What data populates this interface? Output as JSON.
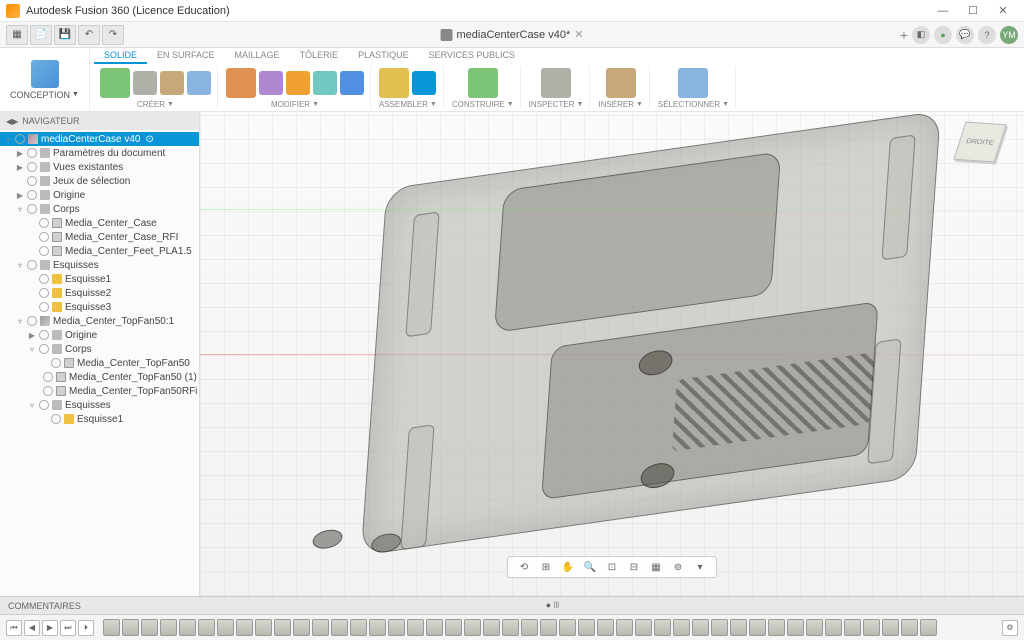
{
  "window": {
    "title": "Autodesk Fusion 360 (Licence Education)",
    "minimize": "—",
    "maximize": "☐",
    "close": "✕"
  },
  "doctab": {
    "name": "mediaCenterCase v40*",
    "add": "+",
    "status": "●",
    "help": "?",
    "user": "YM"
  },
  "ribbon": {
    "workspace": "CONCEPTION",
    "tabs": [
      "SOLIDE",
      "EN SURFACE",
      "MAILLAGE",
      "TÔLERIE",
      "PLASTIQUE",
      "SERVICES PUBLICS"
    ],
    "active_tab": 0,
    "groups": [
      {
        "label": "CRÉER",
        "tools": 4
      },
      {
        "label": "MODIFIER",
        "tools": 5
      },
      {
        "label": "ASSEMBLER",
        "tools": 2
      },
      {
        "label": "CONSTRUIRE",
        "tools": 1
      },
      {
        "label": "INSPECTER",
        "tools": 1
      },
      {
        "label": "INSÉRER",
        "tools": 1
      },
      {
        "label": "SÉLECTIONNER",
        "tools": 1
      }
    ]
  },
  "browser": {
    "title": "NAVIGATEUR",
    "root": "mediaCenterCase v40",
    "nodes": [
      {
        "d": 1,
        "exp": "▶",
        "icon": "gear",
        "label": "Paramètres du document"
      },
      {
        "d": 1,
        "exp": "▶",
        "icon": "folder",
        "label": "Vues existantes"
      },
      {
        "d": 1,
        "exp": "",
        "icon": "folder",
        "label": "Jeux de sélection"
      },
      {
        "d": 1,
        "exp": "▶",
        "icon": "folder",
        "label": "Origine"
      },
      {
        "d": 1,
        "exp": "▿",
        "icon": "folder",
        "label": "Corps"
      },
      {
        "d": 2,
        "exp": "",
        "icon": "body",
        "label": "Media_Center_Case"
      },
      {
        "d": 2,
        "exp": "",
        "icon": "body",
        "label": "Media_Center_Case_RFI"
      },
      {
        "d": 2,
        "exp": "",
        "icon": "body",
        "label": "Media_Center_Feet_PLA1.5"
      },
      {
        "d": 1,
        "exp": "▿",
        "icon": "folder",
        "label": "Esquisses"
      },
      {
        "d": 2,
        "exp": "",
        "icon": "sketch",
        "label": "Esquisse1"
      },
      {
        "d": 2,
        "exp": "",
        "icon": "sketch",
        "label": "Esquisse2"
      },
      {
        "d": 2,
        "exp": "",
        "icon": "sketch",
        "label": "Esquisse3"
      },
      {
        "d": 1,
        "exp": "▿",
        "icon": "comp",
        "label": "Media_Center_TopFan50:1"
      },
      {
        "d": 2,
        "exp": "▶",
        "icon": "folder",
        "label": "Origine"
      },
      {
        "d": 2,
        "exp": "▿",
        "icon": "folder",
        "label": "Corps"
      },
      {
        "d": 3,
        "exp": "",
        "icon": "body",
        "label": "Media_Center_TopFan50"
      },
      {
        "d": 3,
        "exp": "",
        "icon": "body",
        "label": "Media_Center_TopFan50 (1)"
      },
      {
        "d": 3,
        "exp": "",
        "icon": "body",
        "label": "Media_Center_TopFan50RFi"
      },
      {
        "d": 2,
        "exp": "▿",
        "icon": "folder",
        "label": "Esquisses"
      },
      {
        "d": 3,
        "exp": "",
        "icon": "sketch",
        "label": "Esquisse1"
      }
    ]
  },
  "viewcube": {
    "face": "DROITE"
  },
  "viewbar": {
    "tools": [
      "⟲",
      "⊞",
      "✋",
      "🔍",
      "⊡",
      "⊟",
      "▦",
      "⊚",
      "▾"
    ]
  },
  "comments": {
    "label": "COMMENTAIRES",
    "marker": "● ꔖ"
  },
  "timeline": {
    "controls": [
      "⏮",
      "◀",
      "▶",
      "⏭",
      "⏵"
    ],
    "feature_count": 44,
    "settings": "⚙"
  },
  "tool_colors": {
    "sketch": "#7cc576",
    "box": "#b0b0a8",
    "cyl": "#c8a878",
    "fillet": "#8ab4e0",
    "hole": "#e09050",
    "shell": "#b088d0",
    "assemble": "#f0a030",
    "construct": "#70c8c0",
    "inspect": "#5090e0",
    "insert": "#e0c050",
    "select": "#0696d7"
  }
}
